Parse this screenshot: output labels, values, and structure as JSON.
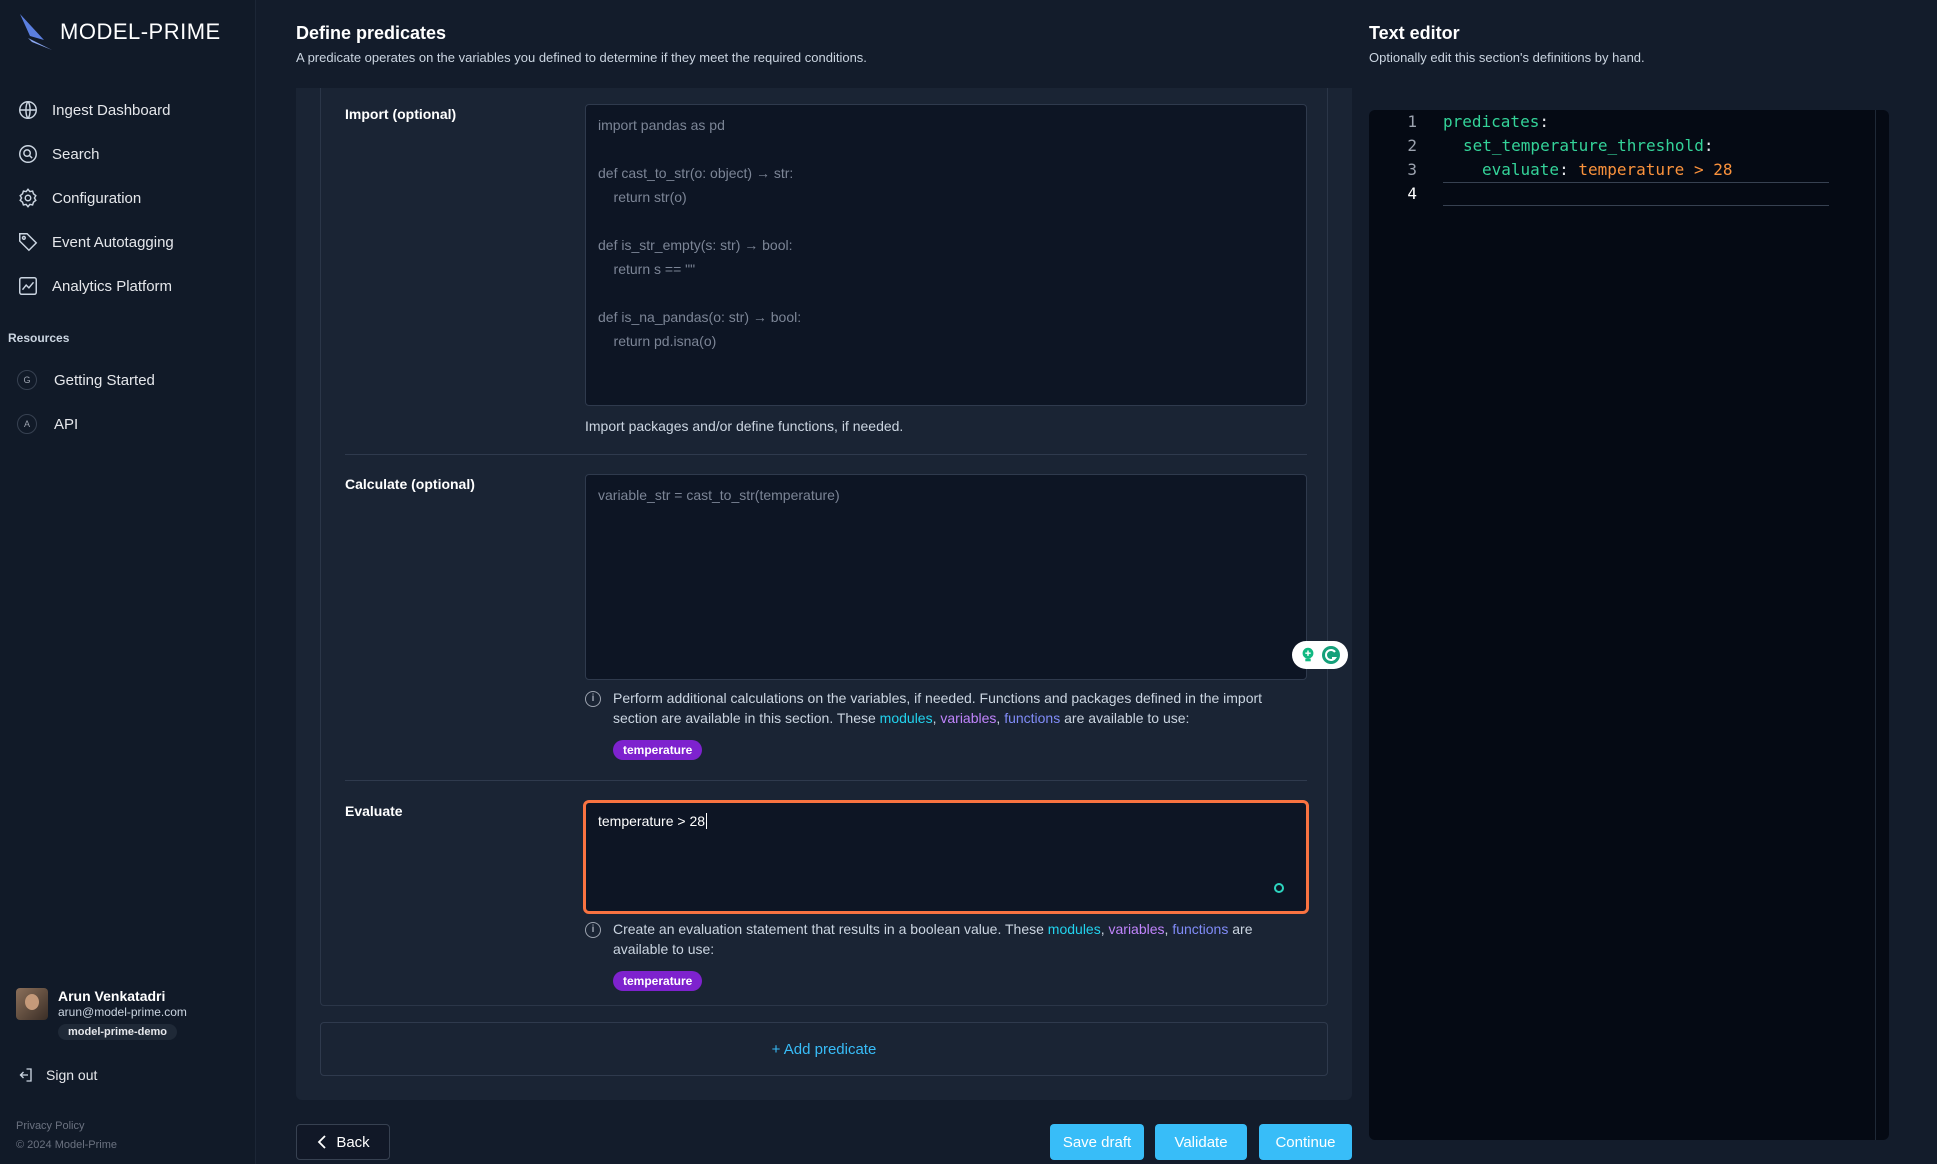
{
  "app": {
    "brand": "MODEL-PRIME"
  },
  "sidebar": {
    "items": [
      {
        "label": "Ingest Dashboard",
        "icon": "globe-icon"
      },
      {
        "label": "Search",
        "icon": "search-icon"
      },
      {
        "label": "Configuration",
        "icon": "gear-icon"
      },
      {
        "label": "Event Autotagging",
        "icon": "tag-icon"
      },
      {
        "label": "Analytics Platform",
        "icon": "chart-icon"
      }
    ],
    "resources_label": "Resources",
    "resources": [
      {
        "letter": "G",
        "label": "Getting Started"
      },
      {
        "letter": "A",
        "label": "API"
      }
    ],
    "user": {
      "name": "Arun Venkatadri",
      "email": "arun@model-prime.com",
      "org": "model-prime-demo"
    },
    "sign_out": "Sign out",
    "privacy": "Privacy Policy",
    "copyright": "© 2024 Model-Prime"
  },
  "main": {
    "title": "Define predicates",
    "subtitle": "A predicate operates on the variables you defined to determine if they meet the required conditions.",
    "import": {
      "label": "Import (optional)",
      "placeholder": "import pandas as pd\n\ndef cast_to_str(o: object) → str:\n    return str(o)\n\ndef is_str_empty(s: str) → bool:\n    return s == \"\"\n\ndef is_na_pandas(o: str) → bool:\n    return pd.isna(o)",
      "help": "Import packages and/or define functions, if needed."
    },
    "calculate": {
      "label": "Calculate (optional)",
      "placeholder": "variable_str = cast_to_str(temperature)",
      "help_pre": "Perform additional calculations on the variables, if needed. Functions and packages defined in the import section are available in this section. These ",
      "chip": "temperature"
    },
    "evaluate": {
      "label": "Evaluate",
      "value": "temperature > 28",
      "help_pre": "Create an evaluation statement that results in a boolean value. These ",
      "chip": "temperature"
    },
    "links": {
      "modules": "modules",
      "variables": "variables",
      "functions": "functions",
      "sep": ", ",
      "are_available": " are available to use:",
      "are": " are",
      "available_to_use": "available to use:"
    },
    "add_predicate": "+ Add predicate",
    "buttons": {
      "back": "Back",
      "save_draft": "Save draft",
      "validate": "Validate",
      "continue": "Continue"
    }
  },
  "text_editor": {
    "title": "Text editor",
    "subtitle": "Optionally edit this section's definitions by hand.",
    "lines": [
      "1",
      "2",
      "3",
      "4"
    ],
    "l1_key": "predicates",
    "l2_key": "set_temperature_threshold",
    "l3_key": "evaluate",
    "l3_value": "temperature > 28",
    "colon": ":"
  },
  "colors": {
    "accent": "#38bdf8",
    "focus_border": "#f97341",
    "chip": "#7e22ce"
  }
}
